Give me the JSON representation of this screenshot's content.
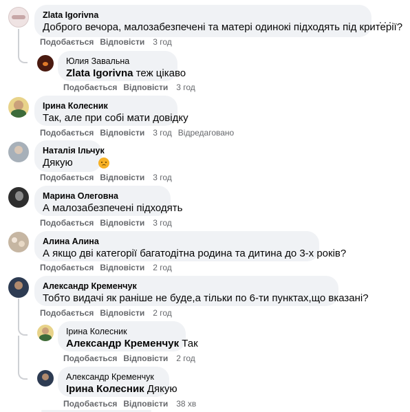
{
  "labels": {
    "like": "Подобається",
    "reply": "Відповісти",
    "edited": "Відредаговано"
  },
  "comments": [
    {
      "author": "Zlata Igorivna",
      "text": "Доброго вечора, малозабезпечені та матері одинокі підходять під критерії?",
      "time": "3 год",
      "avatar_color": "#e9dada"
    },
    {
      "author": "Юлия Завальна",
      "mention": "Zlata Igorivna",
      "text": "теж цікаво",
      "time": "3 год",
      "avatar_color": "#4a1a10"
    },
    {
      "author": "Ірина Колесник",
      "text": "Так, але при собі мати довідку",
      "time": "3 год",
      "avatar_color": "#d9b44a"
    },
    {
      "author": "Наталія Ільчук",
      "text": "Дякую",
      "time": "3 год",
      "avatar_color": "#9aa3ad"
    },
    {
      "author": "Марина Олеговна",
      "text": "А малозабезпечені підходять",
      "time": "3 год",
      "avatar_color": "#3c3c3c"
    },
    {
      "author": "Алина Алина",
      "text": "А якщо дві категорії багатодітна родина та дитина до 3-х років?",
      "time": "2 год",
      "avatar_color": "#b9a58f"
    },
    {
      "author": "Александр Кременчук",
      "text": "Тобто видачі як раніше не буде,а тільки по 6-ти пунктах,що вказані?",
      "time": "2 год",
      "avatar_color": "#2d3b52"
    },
    {
      "author": "Ірина Колесник",
      "mention": "Александр Кременчук",
      "text": "Так",
      "time": "2 год",
      "avatar_color": "#d9b44a"
    },
    {
      "author": "Александр Кременчук",
      "mention": "Ірина Колесник",
      "text": "Дякую",
      "time": "38 хв",
      "avatar_color": "#2d3b52"
    }
  ]
}
